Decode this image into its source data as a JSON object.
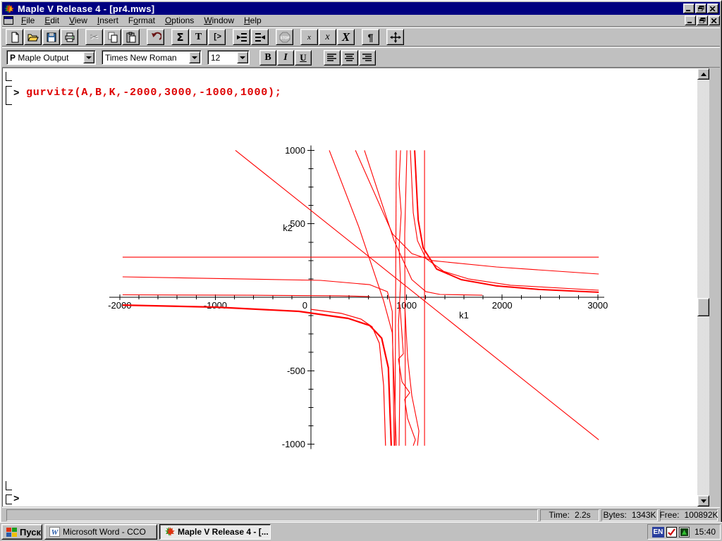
{
  "title_bar": {
    "title": "Maple V Release 4 - [pr4.mws]"
  },
  "menu_bar": {
    "items": [
      {
        "label": "File",
        "u": 0
      },
      {
        "label": "Edit",
        "u": 0
      },
      {
        "label": "View",
        "u": 0
      },
      {
        "label": "Insert",
        "u": 0
      },
      {
        "label": "Format",
        "u": 1
      },
      {
        "label": "Options",
        "u": 0
      },
      {
        "label": "Window",
        "u": 0
      },
      {
        "label": "Help",
        "u": 0
      }
    ]
  },
  "toolbar": {
    "sigma": "Σ",
    "text_mode": "T",
    "input_mode": "[>",
    "x_small": "x",
    "x_medium": "x",
    "x_large": "X",
    "pilcrow": "¶"
  },
  "format_bar": {
    "style_prefix": "P",
    "style": "Maple Output",
    "font": "Times New Roman",
    "size": "12",
    "bold": "B",
    "italic": "I",
    "underline": "U"
  },
  "worksheet": {
    "prompt": ">",
    "command": "gurvitz(A,B,K,-2000,3000,-1000,1000);",
    "prompt_bottom": ">"
  },
  "chart_data": {
    "type": "line",
    "title": "",
    "xlabel": "k1",
    "ylabel": "k2",
    "xlim": [
      -2000,
      3000
    ],
    "ylim": [
      -1000,
      1000
    ],
    "x_major_ticks": [
      -2000,
      -1000,
      0,
      1000,
      2000,
      3000
    ],
    "y_major_ticks": [
      -1000,
      -500,
      500,
      1000
    ],
    "x_minor_step": 200,
    "y_minor_step": 125,
    "grid": false,
    "color": "#ff0000",
    "series": [
      {
        "name": "horizontal-boundary",
        "w": 1.1,
        "pts": [
          [
            -1970,
            273
          ],
          [
            3010,
            273
          ]
        ]
      },
      {
        "name": "upper-left-branch",
        "w": 1.1,
        "pts": [
          [
            -1970,
            139
          ],
          [
            100,
            115
          ],
          [
            615,
            86
          ],
          [
            800,
            38
          ],
          [
            850,
            -96
          ],
          [
            870,
            -1010
          ]
        ]
      },
      {
        "name": "near-axis-left",
        "w": 1.1,
        "pts": [
          [
            -1970,
            17
          ],
          [
            -640,
            14
          ],
          [
            300,
            10
          ],
          [
            615,
            5
          ]
        ]
      },
      {
        "name": "below-axis-thick",
        "w": 2.2,
        "pts": [
          [
            -1970,
            -53
          ],
          [
            -1000,
            -67
          ],
          [
            -125,
            -96
          ],
          [
            390,
            -144
          ],
          [
            615,
            -192
          ],
          [
            740,
            -278
          ],
          [
            810,
            -480
          ],
          [
            840,
            -1010
          ]
        ]
      },
      {
        "name": "below-axis-second",
        "w": 1.2,
        "pts": [
          [
            0,
            -82
          ],
          [
            320,
            -110
          ],
          [
            525,
            -149
          ],
          [
            640,
            -201
          ],
          [
            715,
            -312
          ],
          [
            760,
            -600
          ],
          [
            780,
            -1010
          ]
        ]
      },
      {
        "name": "asymptote-a",
        "w": 1.1,
        "pts": [
          [
            893,
            1000
          ],
          [
            878,
            -1010
          ]
        ]
      },
      {
        "name": "asymptote-b",
        "w": 1.1,
        "pts": [
          [
            937,
            1000
          ],
          [
            922,
            770
          ],
          [
            944,
            575
          ],
          [
            922,
            335
          ],
          [
            937,
            95
          ],
          [
            915,
            -190
          ],
          [
            930,
            -575
          ],
          [
            922,
            -1010
          ]
        ]
      },
      {
        "name": "asymptote-c",
        "w": 1.1,
        "pts": [
          [
            1004,
            1000
          ],
          [
            981,
            430
          ],
          [
            989,
            -1010
          ]
        ]
      },
      {
        "name": "steep-diagonal",
        "w": 1.1,
        "pts": [
          [
            192,
            1000
          ],
          [
            500,
            480
          ],
          [
            760,
            -25
          ],
          [
            850,
            -240
          ],
          [
            893,
            -1010
          ]
        ]
      },
      {
        "name": "diag-to-axis",
        "w": 1.1,
        "pts": [
          [
            560,
            1000
          ],
          [
            870,
            385
          ],
          [
            1055,
            120
          ],
          [
            1203,
            38
          ],
          [
            1350,
            19
          ],
          [
            1793,
            14
          ]
        ]
      },
      {
        "name": "diag-to-gentle",
        "w": 1.1,
        "pts": [
          [
            465,
            1000
          ],
          [
            855,
            430
          ],
          [
            1055,
            297
          ],
          [
            1277,
            249
          ],
          [
            1940,
            206
          ],
          [
            3010,
            158
          ]
        ]
      },
      {
        "name": "hyperbola-1",
        "w": 1.1,
        "pts": [
          [
            1040,
            1000
          ],
          [
            1070,
            575
          ],
          [
            1114,
            385
          ],
          [
            1203,
            264
          ],
          [
            1387,
            177
          ],
          [
            1646,
            125
          ],
          [
            2088,
            82
          ],
          [
            3010,
            48
          ]
        ]
      },
      {
        "name": "hyperbola-2",
        "w": 2.0,
        "pts": [
          [
            1085,
            1000
          ],
          [
            1122,
            527
          ],
          [
            1173,
            336
          ],
          [
            1314,
            192
          ],
          [
            1572,
            120
          ],
          [
            1941,
            77
          ],
          [
            2384,
            53
          ],
          [
            3010,
            34
          ]
        ]
      },
      {
        "name": "vertical-1190",
        "w": 1.1,
        "pts": [
          [
            1188,
            1000
          ],
          [
            1188,
            -1010
          ]
        ]
      },
      {
        "name": "long-diagonal",
        "w": 1.1,
        "pts": [
          [
            -790,
            1000
          ],
          [
            3010,
            -970
          ]
        ]
      },
      {
        "name": "zigzag-1",
        "w": 1.1,
        "pts": [
          [
            930,
            -48
          ],
          [
            967,
            -385
          ],
          [
            915,
            -420
          ],
          [
            952,
            -575
          ],
          [
            1033,
            -650
          ],
          [
            981,
            -695
          ],
          [
            1011,
            -825
          ],
          [
            1092,
            -970
          ],
          [
            1070,
            -1010
          ]
        ]
      },
      {
        "name": "zigzag-2",
        "w": 1.1,
        "pts": [
          [
            981,
            -48
          ],
          [
            1011,
            -410
          ],
          [
            1055,
            -670
          ],
          [
            1129,
            -910
          ],
          [
            1114,
            -1010
          ]
        ]
      }
    ]
  },
  "status_bar": {
    "time_label": "Time:",
    "time_value": "2.2s",
    "bytes_label": "Bytes:",
    "bytes_value": "1343K",
    "free_label": "Free:",
    "free_value": "100892K"
  },
  "taskbar": {
    "start": "Пуск",
    "tasks": [
      {
        "label": "Microsoft Word - CCO",
        "app": "word",
        "active": false
      },
      {
        "label": "Maple V Release 4 - [...",
        "app": "maple",
        "active": true
      }
    ],
    "tray": {
      "lang": "EN",
      "clock": "15:40"
    }
  }
}
